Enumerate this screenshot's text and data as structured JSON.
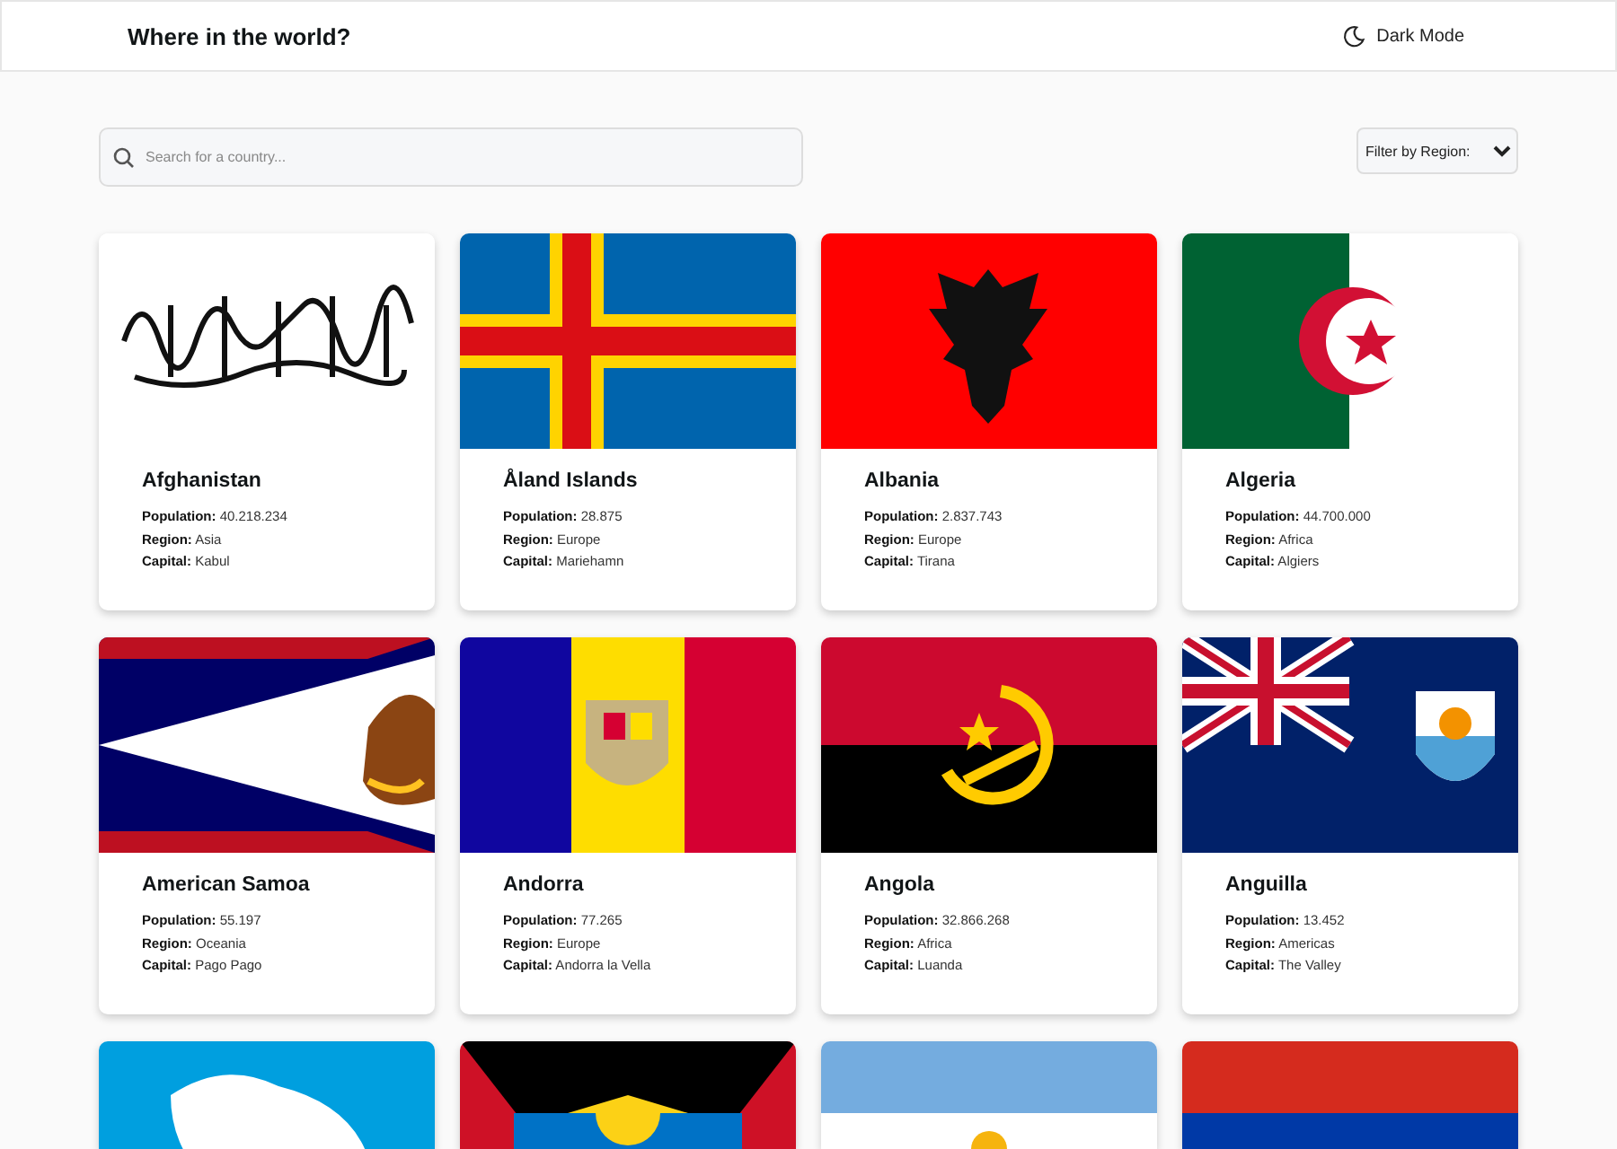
{
  "header": {
    "title": "Where in the world?",
    "theme_toggle": "Dark Mode"
  },
  "search": {
    "placeholder": "Search for a country..."
  },
  "filter": {
    "label": "Filter by Region:"
  },
  "cards": [
    {
      "kind": "full",
      "name": "Afghanistan",
      "population_label": "Population:",
      "population": "40.218.234",
      "region_label": "Region:",
      "region": "Asia",
      "capital_label": "Capital:",
      "capital": "Kabul"
    },
    {
      "kind": "full",
      "name": "Åland Islands",
      "population_label": "Population:",
      "population": "28.875",
      "region_label": "Region:",
      "region": "Europe",
      "capital_label": "Capital:",
      "capital": "Mariehamn"
    },
    {
      "kind": "full",
      "name": "Albania",
      "population_label": "Population:",
      "population": "2.837.743",
      "region_label": "Region:",
      "region": "Europe",
      "capital_label": "Capital:",
      "capital": "Tirana"
    },
    {
      "kind": "full",
      "name": "Algeria",
      "population_label": "Population:",
      "population": "44.700.000",
      "region_label": "Region:",
      "region": "Africa",
      "capital_label": "Capital:",
      "capital": "Algiers"
    },
    {
      "kind": "full",
      "name": "American Samoa",
      "population_label": "Population:",
      "population": "55.197",
      "region_label": "Region:",
      "region": "Oceania",
      "capital_label": "Capital:",
      "capital": "Pago Pago"
    },
    {
      "kind": "full",
      "name": "Andorra",
      "population_label": "Population:",
      "population": "77.265",
      "region_label": "Region:",
      "region": "Europe",
      "capital_label": "Capital:",
      "capital": "Andorra la Vella"
    },
    {
      "kind": "full",
      "name": "Angola",
      "population_label": "Population:",
      "population": "32.866.268",
      "region_label": "Region:",
      "region": "Africa",
      "capital_label": "Capital:",
      "capital": "Luanda"
    },
    {
      "kind": "full",
      "name": "Anguilla",
      "population_label": "Population:",
      "population": "13.452",
      "region_label": "Region:",
      "region": "Americas",
      "capital_label": "Capital:",
      "capital": "The Valley"
    },
    {
      "kind": "cut"
    },
    {
      "kind": "cut"
    },
    {
      "kind": "cut"
    },
    {
      "kind": "cut"
    }
  ]
}
